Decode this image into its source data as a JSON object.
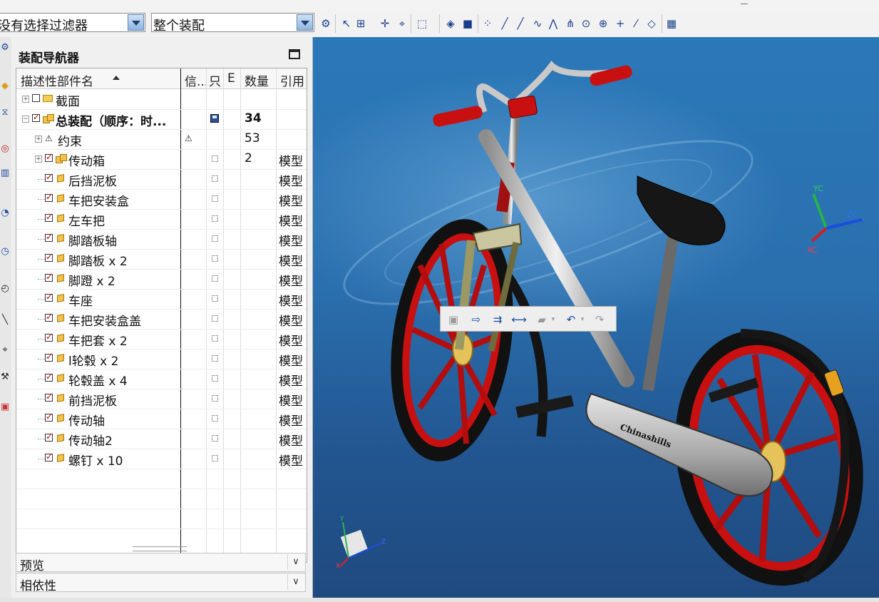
{
  "toolbar": {
    "filter_combo": "没有选择过滤器",
    "scope_combo": "整个装配"
  },
  "navigator": {
    "title": "装配导航器",
    "columns": [
      "描述性部件名",
      "信...",
      "只",
      "E",
      "数量",
      "引用"
    ],
    "rows": [
      {
        "name": "截面",
        "qty": "",
        "ref": "",
        "kind": "folder",
        "expand": "+",
        "check": false,
        "indent": 0
      },
      {
        "name": "总装配（顺序：时...",
        "qty": "34",
        "ref": "",
        "kind": "assy",
        "expand": "-",
        "check": true,
        "indent": 0,
        "bold": true,
        "saved": true
      },
      {
        "name": "约束",
        "qty": "53",
        "ref": "",
        "kind": "constraint",
        "expand": "+",
        "check": null,
        "indent": 1,
        "warn": true
      },
      {
        "name": "传动箱",
        "qty": "2",
        "ref": "模型",
        "kind": "assy",
        "expand": "+",
        "check": true,
        "indent": 1
      },
      {
        "name": "后挡泥板",
        "qty": "",
        "ref": "模型",
        "kind": "part",
        "check": true,
        "indent": 1
      },
      {
        "name": "车把安装盒",
        "qty": "",
        "ref": "模型",
        "kind": "part",
        "check": true,
        "indent": 1
      },
      {
        "name": "左车把",
        "qty": "",
        "ref": "模型",
        "kind": "part",
        "check": true,
        "indent": 1
      },
      {
        "name": "脚踏板轴",
        "qty": "",
        "ref": "模型",
        "kind": "part",
        "check": true,
        "indent": 1
      },
      {
        "name": "脚踏板 x 2",
        "qty": "",
        "ref": "模型",
        "kind": "part",
        "check": true,
        "indent": 1
      },
      {
        "name": "脚蹬 x 2",
        "qty": "",
        "ref": "模型",
        "kind": "part",
        "check": true,
        "indent": 1
      },
      {
        "name": "车座",
        "qty": "",
        "ref": "模型",
        "kind": "part",
        "check": true,
        "indent": 1
      },
      {
        "name": "车把安装盒盖",
        "qty": "",
        "ref": "模型",
        "kind": "part",
        "check": true,
        "indent": 1
      },
      {
        "name": "车把套 x 2",
        "qty": "",
        "ref": "模型",
        "kind": "part",
        "check": true,
        "indent": 1
      },
      {
        "name": "l轮毂 x 2",
        "qty": "",
        "ref": "模型",
        "kind": "part",
        "check": true,
        "indent": 1
      },
      {
        "name": "轮毂盖 x 4",
        "qty": "",
        "ref": "模型",
        "kind": "part",
        "check": true,
        "indent": 1
      },
      {
        "name": "前挡泥板",
        "qty": "",
        "ref": "模型",
        "kind": "part",
        "check": true,
        "indent": 1
      },
      {
        "name": "传动轴",
        "qty": "",
        "ref": "模型",
        "kind": "part",
        "check": true,
        "indent": 1
      },
      {
        "name": "传动轴2",
        "qty": "",
        "ref": "模型",
        "kind": "part",
        "check": true,
        "indent": 1
      },
      {
        "name": "螺钉 x 10",
        "qty": "",
        "ref": "模型",
        "kind": "part",
        "check": true,
        "indent": 1
      }
    ],
    "preview_label": "预览",
    "dependency_label": "相依性"
  },
  "viewport": {
    "triad": {
      "x": "XC",
      "y": "YC",
      "z": "ZC"
    },
    "small_triad": {
      "x": "X",
      "y": "Y",
      "z": "Z"
    },
    "model_text": "Chinashills",
    "colors": {
      "background_top": "#2b78b8",
      "background_bottom": "#1f4a80",
      "wheel": "#c81010",
      "tire": "#111111",
      "frame": "#b9b9b9"
    }
  }
}
